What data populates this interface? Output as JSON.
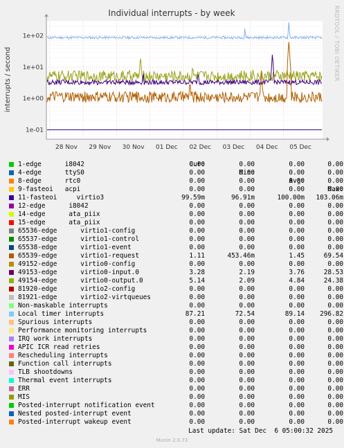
{
  "chart_data": {
    "type": "line",
    "title": "Individual interrupts - by week",
    "ylabel": "interrupts / second",
    "xlabel": "",
    "y_scale": "log",
    "ylim": [
      0.05,
      300
    ],
    "y_ticks": [
      "1e-01",
      "1e+00",
      "1e+01",
      "1e+02"
    ],
    "x_ticks": [
      "28 Nov",
      "29 Nov",
      "30 Nov",
      "01 Dec",
      "02 Dec",
      "03 Dec",
      "04 Dec",
      "05 Dec"
    ],
    "grid": true,
    "series": [
      {
        "name": "Local timer interrupts",
        "color": "#7eb5f0",
        "baseline": 87.21,
        "spread": 0.04,
        "spikes": [
          [
            0.72,
            210
          ],
          [
            0.88,
            296.82
          ]
        ]
      },
      {
        "name": "49154-edge virtio0-output.0",
        "color": "#98a31a",
        "baseline": 5.14,
        "spread": 0.18,
        "spikes": [
          [
            0.34,
            24.38
          ],
          [
            0.53,
            13
          ],
          [
            0.75,
            10
          ]
        ]
      },
      {
        "name": "49153-edge virtio0-input.0",
        "color": "#400080",
        "baseline": 3.28,
        "spread": 0.08,
        "spikes": [
          [
            0.35,
            8
          ],
          [
            0.55,
            8
          ],
          [
            0.82,
            28.53
          ]
        ]
      },
      {
        "name": "65539-edge virtio1-request",
        "color": "#b06000",
        "baseline": 1.11,
        "spread": 0.18,
        "spikes": [
          [
            0.52,
            4
          ],
          [
            0.78,
            8
          ],
          [
            0.88,
            69.54
          ]
        ]
      },
      {
        "name": "11-fasteoi virtio3",
        "color": "#20008a",
        "baseline": 0.1,
        "spread": 0,
        "spikes": []
      }
    ]
  },
  "side_label": "RRDTOOL / TOBI OETIKER",
  "legend": {
    "headers": [
      "Cur:",
      "Min:",
      "Avg:",
      "Max:"
    ],
    "rows": [
      {
        "label": "1-edge      i8042",
        "color": "#00cc00",
        "cur": "0.00",
        "min": "0.00",
        "avg": "0.00",
        "max": "0.00"
      },
      {
        "label": "4-edge      ttyS0",
        "color": "#0066b3",
        "cur": "0.00",
        "min": "0.00",
        "avg": "0.00",
        "max": "0.00"
      },
      {
        "label": "8-edge      rtc0",
        "color": "#ff8000",
        "cur": "0.00",
        "min": "0.00",
        "avg": "0.00",
        "max": "0.00"
      },
      {
        "label": "9-fasteoi   acpi",
        "color": "#ffcc00",
        "cur": "0.00",
        "min": "0.00",
        "avg": "0.00",
        "max": "0.00"
      },
      {
        "label": "11-fasteoi     virtio3",
        "color": "#330099",
        "cur": "99.59m",
        "min": "96.91m",
        "avg": "100.00m",
        "max": "103.06m"
      },
      {
        "label": "12-edge      i8042",
        "color": "#990099",
        "cur": "0.00",
        "min": "0.00",
        "avg": "0.00",
        "max": "0.00"
      },
      {
        "label": "14-edge      ata_piix",
        "color": "#ccff00",
        "cur": "0.00",
        "min": "0.00",
        "avg": "0.00",
        "max": "0.00"
      },
      {
        "label": "15-edge      ata_piix",
        "color": "#ff0000",
        "cur": "0.00",
        "min": "0.00",
        "avg": "0.00",
        "max": "0.00"
      },
      {
        "label": "65536-edge      virtio1-config",
        "color": "#808080",
        "cur": "0.00",
        "min": "0.00",
        "avg": "0.00",
        "max": "0.00"
      },
      {
        "label": "65537-edge      virtio1-control",
        "color": "#008f00",
        "cur": "0.00",
        "min": "0.00",
        "avg": "0.00",
        "max": "0.00"
      },
      {
        "label": "65538-edge      virtio1-event",
        "color": "#00487d",
        "cur": "0.00",
        "min": "0.00",
        "avg": "0.00",
        "max": "0.00"
      },
      {
        "label": "65539-edge      virtio1-request",
        "color": "#b35a00",
        "cur": "1.11",
        "min": "453.46m",
        "avg": "1.45",
        "max": "69.54"
      },
      {
        "label": "49152-edge      virtio0-config",
        "color": "#b38f00",
        "cur": "0.00",
        "min": "0.00",
        "avg": "0.00",
        "max": "0.00"
      },
      {
        "label": "49153-edge      virtio0-input.0",
        "color": "#6b006b",
        "cur": "3.28",
        "min": "2.19",
        "avg": "3.76",
        "max": "28.53"
      },
      {
        "label": "49154-edge      virtio0-output.0",
        "color": "#8fb300",
        "cur": "5.14",
        "min": "2.09",
        "avg": "4.84",
        "max": "24.38"
      },
      {
        "label": "81920-edge      virtio2-config",
        "color": "#b30000",
        "cur": "0.00",
        "min": "0.00",
        "avg": "0.00",
        "max": "0.00"
      },
      {
        "label": "81921-edge      virtio2-virtqueues",
        "color": "#bebebe",
        "cur": "0.00",
        "min": "0.00",
        "avg": "0.00",
        "max": "0.00"
      },
      {
        "label": "Non-maskable interrupts",
        "color": "#80ff80",
        "cur": "0.00",
        "min": "0.00",
        "avg": "0.00",
        "max": "0.00"
      },
      {
        "label": "Local timer interrupts",
        "color": "#80c9ff",
        "cur": "87.21",
        "min": "72.54",
        "avg": "89.14",
        "max": "296.82"
      },
      {
        "label": "Spurious interrupts",
        "color": "#ffc080",
        "cur": "0.00",
        "min": "0.00",
        "avg": "0.00",
        "max": "0.00"
      },
      {
        "label": "Performance monitoring interrupts",
        "color": "#ffe680",
        "cur": "0.00",
        "min": "0.00",
        "avg": "0.00",
        "max": "0.00"
      },
      {
        "label": "IRQ work interrupts",
        "color": "#aa80ff",
        "cur": "0.00",
        "min": "0.00",
        "avg": "0.00",
        "max": "0.00"
      },
      {
        "label": "APIC ICR read retries",
        "color": "#ee00cc",
        "cur": "0.00",
        "min": "0.00",
        "avg": "0.00",
        "max": "0.00"
      },
      {
        "label": "Rescheduling interrupts",
        "color": "#ff8080",
        "cur": "0.00",
        "min": "0.00",
        "avg": "0.00",
        "max": "0.00"
      },
      {
        "label": "Function call interrupts",
        "color": "#666600",
        "cur": "0.00",
        "min": "0.00",
        "avg": "0.00",
        "max": "0.00"
      },
      {
        "label": "TLB shootdowns",
        "color": "#ffbfff",
        "cur": "0.00",
        "min": "0.00",
        "avg": "0.00",
        "max": "0.00"
      },
      {
        "label": "Thermal event interrupts",
        "color": "#00ffcc",
        "cur": "0.00",
        "min": "0.00",
        "avg": "0.00",
        "max": "0.00"
      },
      {
        "label": "ERR",
        "color": "#cc6699",
        "cur": "0.00",
        "min": "0.00",
        "avg": "0.00",
        "max": "0.00"
      },
      {
        "label": "MIS",
        "color": "#999900",
        "cur": "0.00",
        "min": "0.00",
        "avg": "0.00",
        "max": "0.00"
      },
      {
        "label": "Posted-interrupt notification event",
        "color": "#00cc00",
        "cur": "0.00",
        "min": "0.00",
        "avg": "0.00",
        "max": "0.00"
      },
      {
        "label": "Nested posted-interrupt event",
        "color": "#0066b3",
        "cur": "0.00",
        "min": "0.00",
        "avg": "0.00",
        "max": "0.00"
      },
      {
        "label": "Posted-interrupt wakeup event",
        "color": "#ff8000",
        "cur": "0.00",
        "min": "0.00",
        "avg": "0.00",
        "max": "0.00"
      }
    ]
  },
  "last_update": "Last update: Sat Dec  6 05:00:32 2025",
  "footer": "Munin 2.0.73"
}
